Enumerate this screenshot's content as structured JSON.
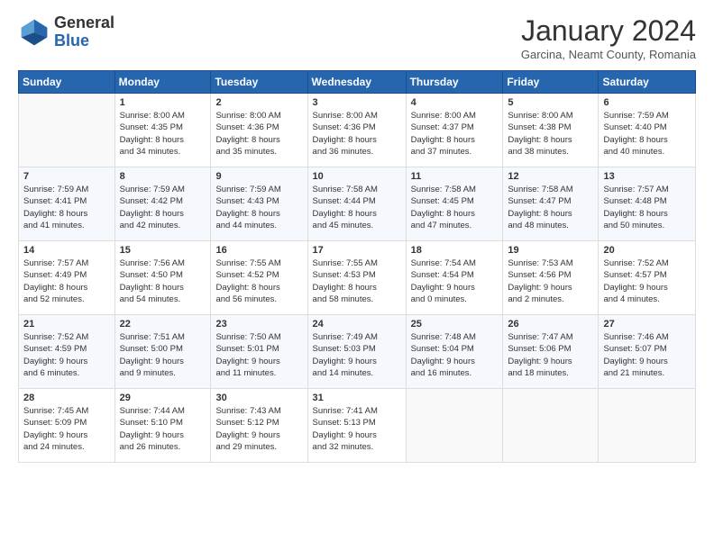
{
  "header": {
    "logo_general": "General",
    "logo_blue": "Blue",
    "month_title": "January 2024",
    "subtitle": "Garcina, Neamt County, Romania"
  },
  "days_of_week": [
    "Sunday",
    "Monday",
    "Tuesday",
    "Wednesday",
    "Thursday",
    "Friday",
    "Saturday"
  ],
  "weeks": [
    [
      {
        "day": "",
        "sunrise": "",
        "sunset": "",
        "daylight": ""
      },
      {
        "day": "1",
        "sunrise": "Sunrise: 8:00 AM",
        "sunset": "Sunset: 4:35 PM",
        "daylight": "Daylight: 8 hours and 34 minutes."
      },
      {
        "day": "2",
        "sunrise": "Sunrise: 8:00 AM",
        "sunset": "Sunset: 4:36 PM",
        "daylight": "Daylight: 8 hours and 35 minutes."
      },
      {
        "day": "3",
        "sunrise": "Sunrise: 8:00 AM",
        "sunset": "Sunset: 4:36 PM",
        "daylight": "Daylight: 8 hours and 36 minutes."
      },
      {
        "day": "4",
        "sunrise": "Sunrise: 8:00 AM",
        "sunset": "Sunset: 4:37 PM",
        "daylight": "Daylight: 8 hours and 37 minutes."
      },
      {
        "day": "5",
        "sunrise": "Sunrise: 8:00 AM",
        "sunset": "Sunset: 4:38 PM",
        "daylight": "Daylight: 8 hours and 38 minutes."
      },
      {
        "day": "6",
        "sunrise": "Sunrise: 7:59 AM",
        "sunset": "Sunset: 4:40 PM",
        "daylight": "Daylight: 8 hours and 40 minutes."
      }
    ],
    [
      {
        "day": "7",
        "sunrise": "Sunrise: 7:59 AM",
        "sunset": "Sunset: 4:41 PM",
        "daylight": "Daylight: 8 hours and 41 minutes."
      },
      {
        "day": "8",
        "sunrise": "Sunrise: 7:59 AM",
        "sunset": "Sunset: 4:42 PM",
        "daylight": "Daylight: 8 hours and 42 minutes."
      },
      {
        "day": "9",
        "sunrise": "Sunrise: 7:59 AM",
        "sunset": "Sunset: 4:43 PM",
        "daylight": "Daylight: 8 hours and 44 minutes."
      },
      {
        "day": "10",
        "sunrise": "Sunrise: 7:58 AM",
        "sunset": "Sunset: 4:44 PM",
        "daylight": "Daylight: 8 hours and 45 minutes."
      },
      {
        "day": "11",
        "sunrise": "Sunrise: 7:58 AM",
        "sunset": "Sunset: 4:45 PM",
        "daylight": "Daylight: 8 hours and 47 minutes."
      },
      {
        "day": "12",
        "sunrise": "Sunrise: 7:58 AM",
        "sunset": "Sunset: 4:47 PM",
        "daylight": "Daylight: 8 hours and 48 minutes."
      },
      {
        "day": "13",
        "sunrise": "Sunrise: 7:57 AM",
        "sunset": "Sunset: 4:48 PM",
        "daylight": "Daylight: 8 hours and 50 minutes."
      }
    ],
    [
      {
        "day": "14",
        "sunrise": "Sunrise: 7:57 AM",
        "sunset": "Sunset: 4:49 PM",
        "daylight": "Daylight: 8 hours and 52 minutes."
      },
      {
        "day": "15",
        "sunrise": "Sunrise: 7:56 AM",
        "sunset": "Sunset: 4:50 PM",
        "daylight": "Daylight: 8 hours and 54 minutes."
      },
      {
        "day": "16",
        "sunrise": "Sunrise: 7:55 AM",
        "sunset": "Sunset: 4:52 PM",
        "daylight": "Daylight: 8 hours and 56 minutes."
      },
      {
        "day": "17",
        "sunrise": "Sunrise: 7:55 AM",
        "sunset": "Sunset: 4:53 PM",
        "daylight": "Daylight: 8 hours and 58 minutes."
      },
      {
        "day": "18",
        "sunrise": "Sunrise: 7:54 AM",
        "sunset": "Sunset: 4:54 PM",
        "daylight": "Daylight: 9 hours and 0 minutes."
      },
      {
        "day": "19",
        "sunrise": "Sunrise: 7:53 AM",
        "sunset": "Sunset: 4:56 PM",
        "daylight": "Daylight: 9 hours and 2 minutes."
      },
      {
        "day": "20",
        "sunrise": "Sunrise: 7:52 AM",
        "sunset": "Sunset: 4:57 PM",
        "daylight": "Daylight: 9 hours and 4 minutes."
      }
    ],
    [
      {
        "day": "21",
        "sunrise": "Sunrise: 7:52 AM",
        "sunset": "Sunset: 4:59 PM",
        "daylight": "Daylight: 9 hours and 6 minutes."
      },
      {
        "day": "22",
        "sunrise": "Sunrise: 7:51 AM",
        "sunset": "Sunset: 5:00 PM",
        "daylight": "Daylight: 9 hours and 9 minutes."
      },
      {
        "day": "23",
        "sunrise": "Sunrise: 7:50 AM",
        "sunset": "Sunset: 5:01 PM",
        "daylight": "Daylight: 9 hours and 11 minutes."
      },
      {
        "day": "24",
        "sunrise": "Sunrise: 7:49 AM",
        "sunset": "Sunset: 5:03 PM",
        "daylight": "Daylight: 9 hours and 14 minutes."
      },
      {
        "day": "25",
        "sunrise": "Sunrise: 7:48 AM",
        "sunset": "Sunset: 5:04 PM",
        "daylight": "Daylight: 9 hours and 16 minutes."
      },
      {
        "day": "26",
        "sunrise": "Sunrise: 7:47 AM",
        "sunset": "Sunset: 5:06 PM",
        "daylight": "Daylight: 9 hours and 18 minutes."
      },
      {
        "day": "27",
        "sunrise": "Sunrise: 7:46 AM",
        "sunset": "Sunset: 5:07 PM",
        "daylight": "Daylight: 9 hours and 21 minutes."
      }
    ],
    [
      {
        "day": "28",
        "sunrise": "Sunrise: 7:45 AM",
        "sunset": "Sunset: 5:09 PM",
        "daylight": "Daylight: 9 hours and 24 minutes."
      },
      {
        "day": "29",
        "sunrise": "Sunrise: 7:44 AM",
        "sunset": "Sunset: 5:10 PM",
        "daylight": "Daylight: 9 hours and 26 minutes."
      },
      {
        "day": "30",
        "sunrise": "Sunrise: 7:43 AM",
        "sunset": "Sunset: 5:12 PM",
        "daylight": "Daylight: 9 hours and 29 minutes."
      },
      {
        "day": "31",
        "sunrise": "Sunrise: 7:41 AM",
        "sunset": "Sunset: 5:13 PM",
        "daylight": "Daylight: 9 hours and 32 minutes."
      },
      {
        "day": "",
        "sunrise": "",
        "sunset": "",
        "daylight": ""
      },
      {
        "day": "",
        "sunrise": "",
        "sunset": "",
        "daylight": ""
      },
      {
        "day": "",
        "sunrise": "",
        "sunset": "",
        "daylight": ""
      }
    ]
  ]
}
